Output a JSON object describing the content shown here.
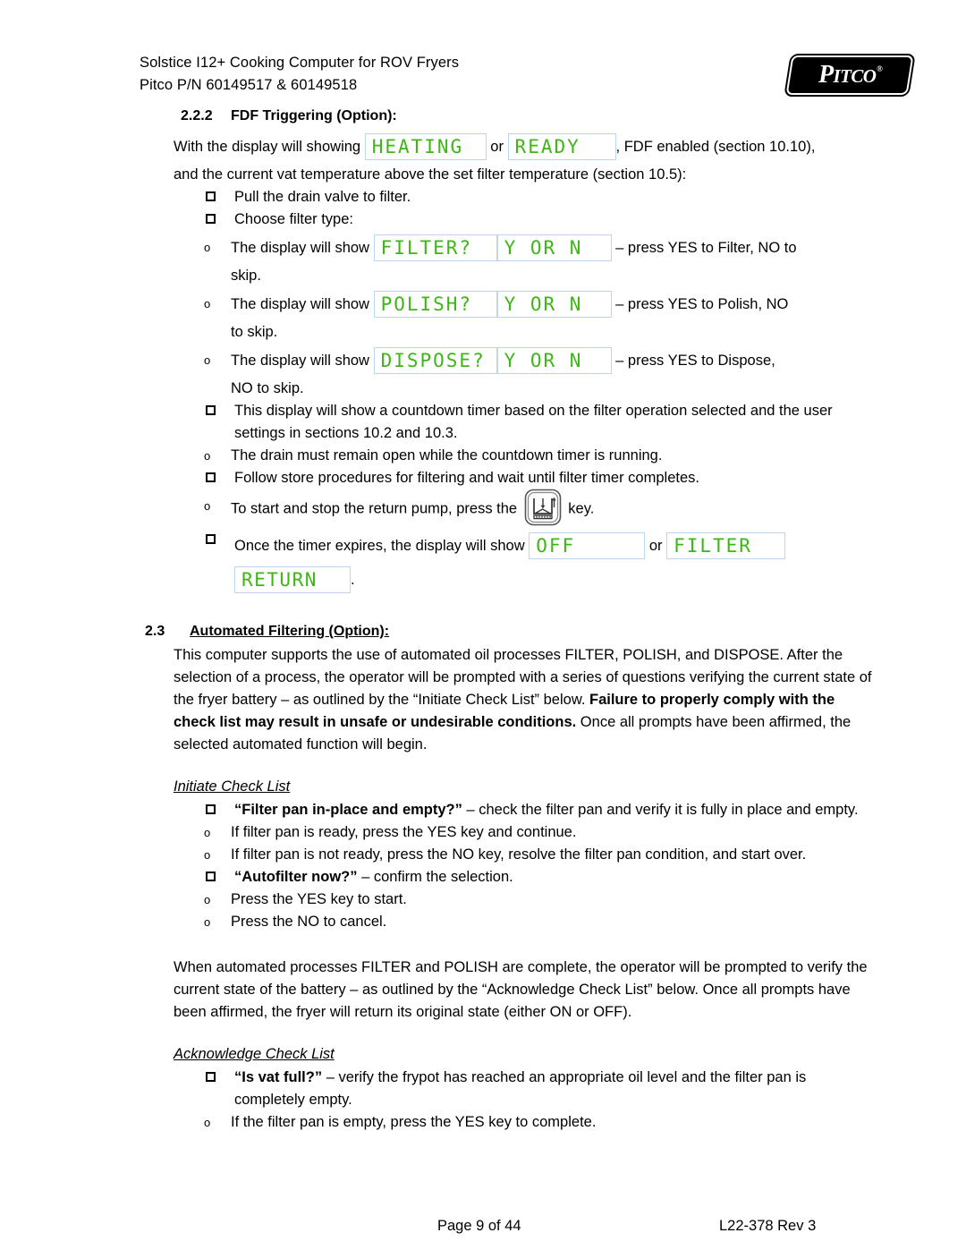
{
  "header": {
    "line1": "Solstice I12+ Cooking Computer for ROV Fryers",
    "line2": "Pitco P/N 60149517 & 60149518",
    "logo_main": "P",
    "logo_rest": "ITCO",
    "logo_reg": "®",
    "logo_alt": "pitco-logo"
  },
  "section_222": {
    "number": "2.2.2",
    "title": "FDF Triggering (Option):",
    "lead_part1": "With the display will showing",
    "lead_led1": "HEATING",
    "lead_or": "or",
    "lead_led2": "READY",
    "lead_part2": ", FDF enabled (section 10.10),",
    "lead_line2": "and the current vat temperature above the set filter temperature (section 10.5):",
    "items": {
      "pull_drain": "Pull the drain valve to filter.",
      "choose_filter_type": "Choose filter type:",
      "filter_pre": "The display will show",
      "filter_led": "FILTER?",
      "filter_yorn": "Y OR N",
      "filter_post": "– press YES to Filter, NO to",
      "filter_cont": "skip.",
      "polish_pre": "The display will show",
      "polish_led": "POLISH?",
      "polish_yorn": "Y OR N",
      "polish_post": "– press YES to Polish, NO",
      "polish_cont": "to skip.",
      "dispose_pre": "The display will show",
      "dispose_led": "DISPOSE?",
      "dispose_yorn": "Y OR N",
      "dispose_post": "– press YES to Dispose,",
      "dispose_cont": "NO to skip.",
      "countdown": "This display will show a countdown timer based on the filter operation selected and the user settings in sections 10.2 and 10.3.",
      "drain_open": "The drain must remain open while the countdown timer is running.",
      "follow_store": "Follow store procedures for filtering and wait until filter timer completes.",
      "return_pump_pre": "To start and stop the return pump, press the",
      "return_pump_icon": "return-pump-key-icon",
      "return_pump_post": "key.",
      "timer_expires_pre": "Once the timer expires, the display will show",
      "timer_led_off": "OFF",
      "timer_or": "or",
      "timer_led_filter": "FILTER",
      "timer_led_return": "RETURN",
      "timer_period": "."
    }
  },
  "section_23": {
    "number": "2.3",
    "title": "Automated Filtering (Option):",
    "para1_a": "This computer supports the use of automated oil processes FILTER, POLISH, and DISPOSE. After the selection of a process, the operator will be prompted with a series of questions verifying the current state of the fryer battery – as outlined by the “Initiate Check List” below.  ",
    "para1_bold": "Failure to properly comply with the check list may result in unsafe or undesirable conditions.",
    "para1_b": "  Once all prompts have been affirmed, the selected automated function will begin.",
    "initiate_title": "Initiate Check List",
    "initiate": {
      "item1_bold": "“Filter pan in-place and empty?”",
      "item1_rest": " – check the filter pan and verify it is fully in place and empty.",
      "sub1": "If filter pan is ready, press the YES key and continue.",
      "sub2": "If filter pan is not ready, press the NO key, resolve the filter pan condition, and start over.",
      "item2_bold": "“Autofilter now?”",
      "item2_rest": " – confirm the selection.",
      "sub3": "Press the YES key to start.",
      "sub4": "Press the NO to cancel."
    },
    "para2": "When automated processes FILTER and POLISH are complete, the operator will be prompted to verify the current state of the battery – as outlined by the “Acknowledge Check List” below.  Once all prompts have been affirmed, the fryer will return its original state (either ON or OFF).",
    "acknowledge_title": "Acknowledge Check List",
    "acknowledge": {
      "item1_bold": "“Is vat full?”",
      "item1_rest": " – verify the frypot has reached an appropriate oil level and the filter pan is completely empty.",
      "sub1": "If the filter pan is empty, press the YES key to complete."
    }
  },
  "footer": {
    "page": "Page 9 of 44",
    "doc": "L22-378 Rev 3"
  },
  "colors": {
    "led_green": "#3fb618",
    "led_border": "#bcd6ef",
    "text": "#000000"
  }
}
